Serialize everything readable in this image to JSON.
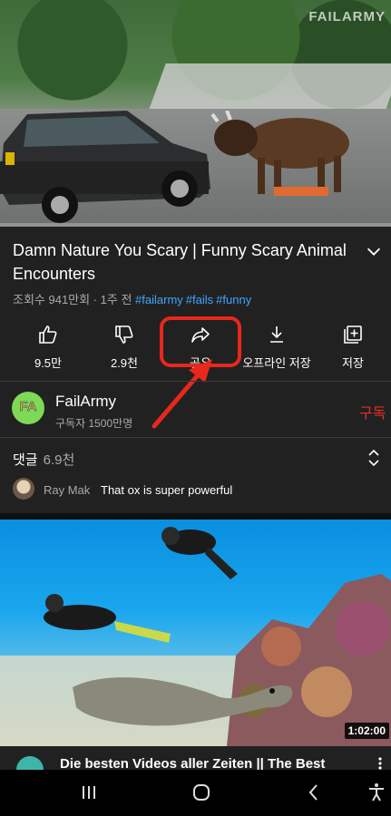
{
  "video": {
    "watermark": "FAILARMY",
    "progress_percent": 0,
    "title": "Damn Nature You Scary | Funny Scary Animal Encounters",
    "meta_text": "조회수 941만회 · 1주 전",
    "tags": [
      "#failarmy",
      "#fails",
      "#funny"
    ]
  },
  "actions": [
    {
      "name": "like",
      "icon": "thumbs-up-icon",
      "label": "9.5만"
    },
    {
      "name": "dislike",
      "icon": "thumbs-down-icon",
      "label": "2.9천"
    },
    {
      "name": "share",
      "icon": "share-icon",
      "label": "공유"
    },
    {
      "name": "download",
      "icon": "download-icon",
      "label": "오프라인 저장"
    },
    {
      "name": "save",
      "icon": "add-to-playlist-icon",
      "label": "저장"
    }
  ],
  "highlight_color": "#e8271d",
  "channel": {
    "avatar_text": "FA",
    "name": "FailArmy",
    "subscribers": "구독자 1500만명",
    "subscribe_label": "구독"
  },
  "comments": {
    "header": "댓글",
    "count": "6.9천",
    "top_user": "Ray Mak",
    "top_text": "That ox is super powerful"
  },
  "next_video": {
    "duration": "1:02:00",
    "title": "Die besten Videos aller Zeiten || The Best"
  },
  "nav": [
    "recent-apps-icon",
    "home-icon",
    "back-icon",
    "accessibility-icon"
  ]
}
